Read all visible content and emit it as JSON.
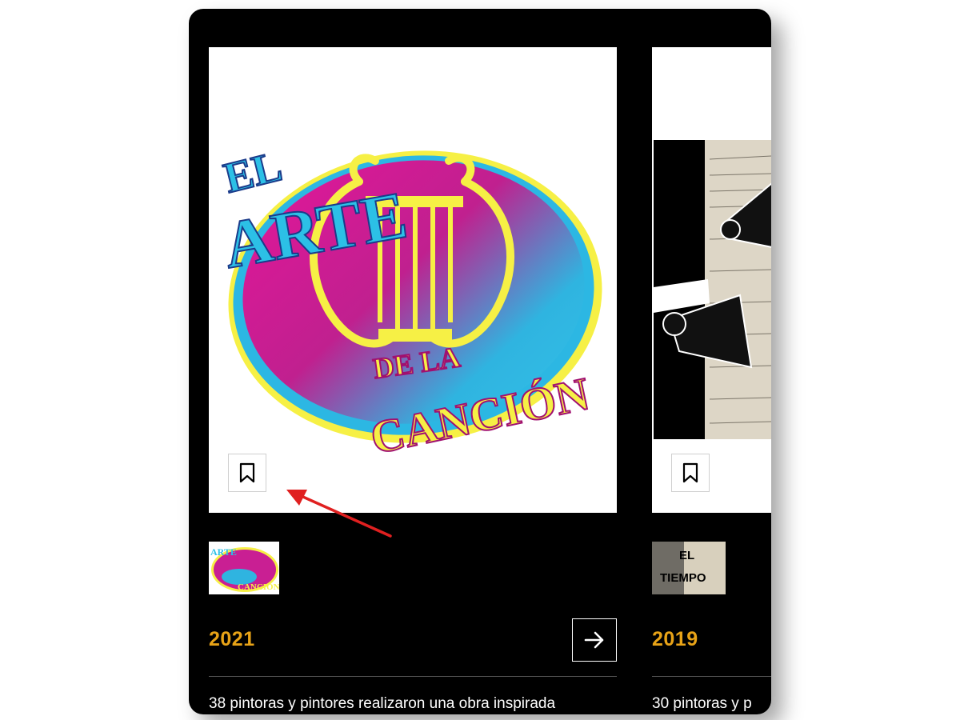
{
  "colors": {
    "background": "#000000",
    "year_accent": "#E8A317",
    "annotation_arrow": "#E02020"
  },
  "cards": [
    {
      "year": "2021",
      "image_logo": {
        "line1": "EL",
        "line2": "ARTE",
        "line3": "DE LA",
        "line4": "CANCIÓN"
      },
      "bookmark_icon": "bookmark-icon",
      "thumbnail_icon": "el-arte-de-la-cancion-thumbnail",
      "next_icon": "arrow-right-icon",
      "description": "38 pintoras y pintores realizaron una obra inspirada"
    },
    {
      "year": "2019",
      "thumbnail_text": {
        "line1": "EL",
        "line2": "TIEMPO"
      },
      "bookmark_icon": "bookmark-icon",
      "description": "30 pintoras y p"
    }
  ]
}
